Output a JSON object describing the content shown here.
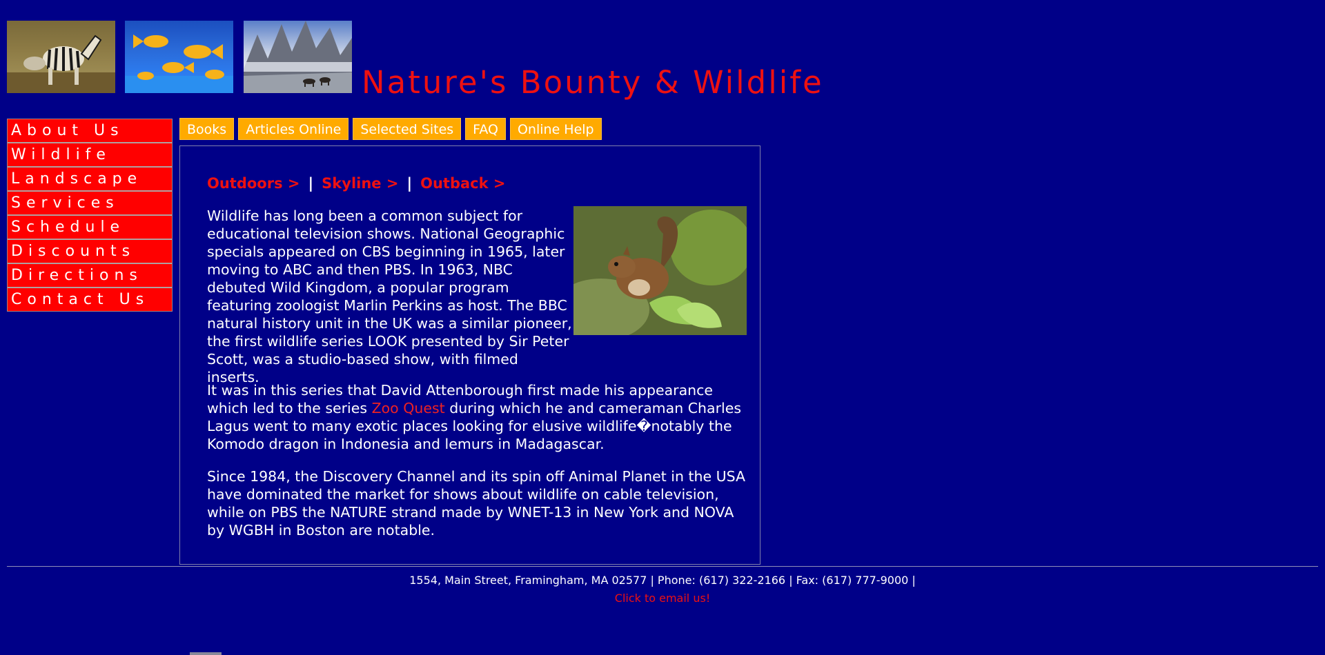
{
  "header": {
    "title": "Nature's Bounty & Wildlife",
    "images": [
      {
        "icon": "zebra-image"
      },
      {
        "icon": "goldfish-image"
      },
      {
        "icon": "mountain-goat-image"
      }
    ]
  },
  "side_menu": {
    "items": [
      {
        "label": "About Us"
      },
      {
        "label": "Wildlife"
      },
      {
        "label": "Landscape"
      },
      {
        "label": "Services"
      },
      {
        "label": "Schedule"
      },
      {
        "label": "Discounts"
      },
      {
        "label": "Directions"
      },
      {
        "label": "Contact Us"
      }
    ],
    "color": "#ff0000"
  },
  "tabs": {
    "items": [
      {
        "label": "Books"
      },
      {
        "label": "Articles Online"
      },
      {
        "label": "Selected Sites"
      },
      {
        "label": "FAQ"
      },
      {
        "label": "Online Help"
      }
    ],
    "color": "#ffaa00"
  },
  "content": {
    "breadcrumbs": [
      {
        "label": "Outdoors >"
      },
      {
        "label": "Skyline >"
      },
      {
        "label": "Outback >"
      }
    ],
    "separator": "|",
    "image": {
      "icon": "squirrel-image"
    },
    "p1": "Wildlife has long been a common subject for educational television shows. National Geographic specials appeared on CBS beginning in 1965, later moving to ABC and then PBS. In 1963, NBC debuted Wild Kingdom, a popular program featuring zoologist Marlin Perkins as host. The BBC natural history unit in the UK was a similar pioneer, the first wildlife series LOOK presented by Sir Peter Scott, was a studio-based show, with filmed inserts.",
    "p2_before": "It was in this series that David Attenborough first made his appearance which led to the series ",
    "p2_link": "Zoo Quest",
    "p2_after": " during which he and cameraman Charles Lagus went to many exotic places looking for elusive wildlife�notably the Komodo dragon in Indonesia and lemurs in Madagascar.",
    "p3": "Since 1984, the Discovery Channel and its spin off Animal Planet in the USA have dominated the market for shows about wildlife on cable television, while on PBS the NATURE strand made by WNET-13 in New York and NOVA by WGBH in Boston are notable."
  },
  "footer": {
    "address": "1554, Main Street, Framingham, MA 02577 | Phone: (617) 322-2166 | Fax: (617) 777-9000 |",
    "email_link": "Click to email us!"
  },
  "colors": {
    "background": "#000088",
    "accent_red": "#ee1111",
    "text": "#ffffff"
  }
}
